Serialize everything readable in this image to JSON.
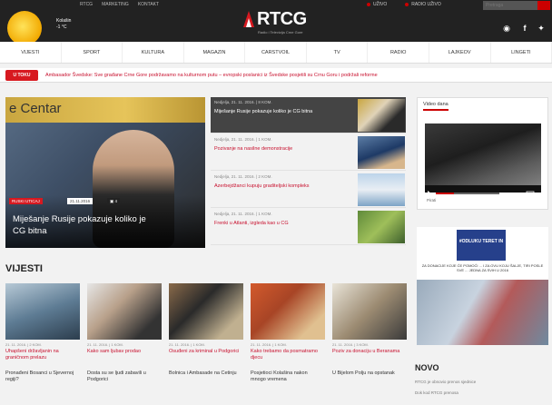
{
  "header": {
    "top_links": [
      "RTCG",
      "MARKETING",
      "KONTAKT"
    ],
    "weather": {
      "city": "Kolašin",
      "temp": "-1 °C"
    },
    "logo": {
      "name": "RTCG",
      "tagline": "Radio i Televizija Crne Gore"
    },
    "right_links": [
      "UŽIVO",
      "RADIO UŽIVO"
    ],
    "search_placeholder": "Pretraga",
    "social": [
      "rss-icon",
      "facebook-icon",
      "twitter-icon"
    ]
  },
  "nav": [
    "VIJESTI",
    "SPORT",
    "KULTURA",
    "MAGAZIN",
    "CARSTVOIL",
    "TV",
    "RADIO",
    "LAJKEOV",
    "LINGETI"
  ],
  "ticker": {
    "badge": "U TOKU",
    "text": "Ambasador Švedske: Sve građane Crne Gore podržavamo na kulturnom putu – evropski poslanici iz Švedske posjetili su Crnu Goru i podržali reforme"
  },
  "main_story": {
    "sign": "e Centar",
    "tag": "RUSKI UTICAJ",
    "date": "21.11.2016",
    "comments": "4",
    "title": "Miješanje Rusije pokazuje koliko je CG bitna"
  },
  "stories": [
    {
      "meta": "Nedjelja, 21. 11. 2016.  |  8 KOM.",
      "title": "Miješanje Rusije pokazuje koliko je CG bitna"
    },
    {
      "meta": "Nedjelja, 21. 11. 2016.  |  1 KOM.",
      "title": "Pozivanje na nasilne demonstracije"
    },
    {
      "meta": "Nedjelja, 21. 11. 2016.  |  2 KOM.",
      "title": "Azerbejdžanci kupuju graditeljski kompleks"
    },
    {
      "meta": "Nedjelja, 21. 11. 2016.  |  1 KOM.",
      "title": "Frenki u Atlanti, izgleda kao u CG"
    }
  ],
  "video": {
    "tab": "Video dana",
    "caption": "Pirati"
  },
  "ad": {
    "logo": "#ODLUKU TERET IN",
    "text": "ZA DONACIJE KOJE ĆE POMOĆI ... I ZA OVU KOJU ŠALJE, TIRI POSLE SVE ... JEDNA ZA SVIH U 2016"
  },
  "vijesti": {
    "title": "VIJESTI",
    "cards": [
      {
        "meta": "21. 11. 2016.  |  2 KOM.",
        "title": "Uhapšeni državljanin na graničnom prelazu",
        "sub": "Pronađeni Bosanci u Sjevernoj regiji?"
      },
      {
        "meta": "21. 11. 2016.  |  1 KOM.",
        "title": "Kako sam ljubav prodao",
        "sub": "Dosta su se ljudi zabavili u Podgorici"
      },
      {
        "meta": "21. 11. 2016.  |  1 KOM.",
        "title": "Osuđeni za kriminal u Podgorici",
        "sub": "Bolnica i Ambasade na Cetinju"
      },
      {
        "meta": "21. 11. 2016.  |  1 KOM.",
        "title": "Kako trebamo da posmatramo djecu",
        "sub": "Posjetioci Kolašina nakon mnogo vremena"
      },
      {
        "meta": "21. 11. 2016.  |  3 KOM.",
        "title": "Poziv za donaciju u Beranama",
        "sub": "U Bijelom Polju na opstanak"
      }
    ]
  },
  "novo": {
    "title": "NOVO",
    "lines": [
      "RTCG je obnovio prenos sjednice",
      "Dok kod RTCG prenosa"
    ]
  }
}
